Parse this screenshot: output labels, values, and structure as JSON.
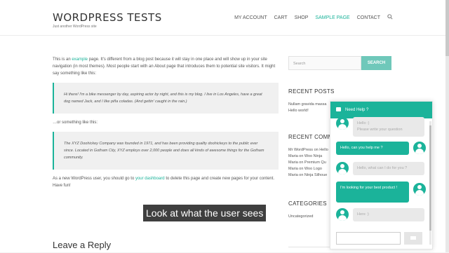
{
  "site": {
    "title": "WORDPRESS TESTS",
    "tagline": "Just another WordPress site"
  },
  "nav": {
    "items": [
      "MY ACCOUNT",
      "CART",
      "SHOP",
      "SAMPLE PAGE",
      "CONTACT"
    ],
    "active_index": 3,
    "search_icon": "search-icon"
  },
  "content": {
    "p1_a": "This is an ",
    "p1_link": "example",
    "p1_b": " page. It's different from a blog post because it will stay in one place and will show up in your site navigation (in most themes). Most people start with an About page that introduces them to potential site visitors. It might say something like this:",
    "quote1": "Hi there! I'm a bike messenger by day, aspiring actor by night, and this is my blog. I live in Los Angeles, have a great dog named Jack, and I like piña coladas. (And gettin' caught in the rain.)",
    "p2": "…or something like this:",
    "quote2": "The XYZ Doohickey Company was founded in 1971, and has been providing quality doohickeys to the public ever since. Located in Gotham City, XYZ employs over 2,000 people and does all kinds of awesome things for the Gotham community.",
    "p3_a": "As a new WordPress user, you should go to ",
    "p3_link": "your dashboard",
    "p3_b": " to delete this page and create new pages for your content. Have fun!",
    "reply_title": "Leave a Reply"
  },
  "sidebar": {
    "search_placeholder": "Search",
    "search_button": "SEARCH",
    "recent_posts_title": "RECENT POSTS",
    "recent_posts": [
      "Nullam gravida massa",
      "Hello world!"
    ],
    "recent_comments_title": "RECENT COMME",
    "recent_comments": [
      "Mr WordPress on Hello",
      "Maria on Woo Ninja",
      "Maria on Premium Qu",
      "Maria on Woo Logo",
      "Maria on Ninja Silhoue"
    ],
    "categories_title": "CATEGORIES",
    "categories": [
      "Uncategorized"
    ]
  },
  "caption": "Look at what the user sees",
  "chat": {
    "header": "Need Help ?",
    "header_icon": "chat-bubble-icon",
    "messages": [
      {
        "from": "agent",
        "text": "Hello :)",
        "sub": "Please write your question"
      },
      {
        "from": "user",
        "text": "Hello, can you help me ?"
      },
      {
        "from": "agent",
        "text": "Hello, what can I do for you ?"
      },
      {
        "from": "user",
        "text": "I'm looking for your best product !"
      },
      {
        "from": "agent",
        "text": "Here :)"
      }
    ],
    "accent": "#1bb39a"
  }
}
